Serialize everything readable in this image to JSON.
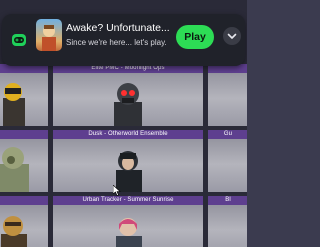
{
  "notification": {
    "title": "Awake? Unfortunate...",
    "subtitle": "Since we're here... let's play.",
    "play_label": "Play",
    "accent": "#2ddc55",
    "badge_icon": "gamepad-icon",
    "expand_icon": "chevron-down-icon"
  },
  "skins": [
    {
      "title": ""
    },
    {
      "title": "Elite PMC - Moonlight Ops"
    },
    {
      "title": ""
    },
    {
      "title": ""
    },
    {
      "title": "Dusk - Otherworld Ensemble"
    },
    {
      "title": "Gu"
    },
    {
      "title": ""
    },
    {
      "title": "Urban Tracker - Summer Sunrise"
    },
    {
      "title": "Bl"
    }
  ],
  "colors": {
    "title_bar": "#5e3f8f",
    "card_bg": "#a8a8b2"
  }
}
